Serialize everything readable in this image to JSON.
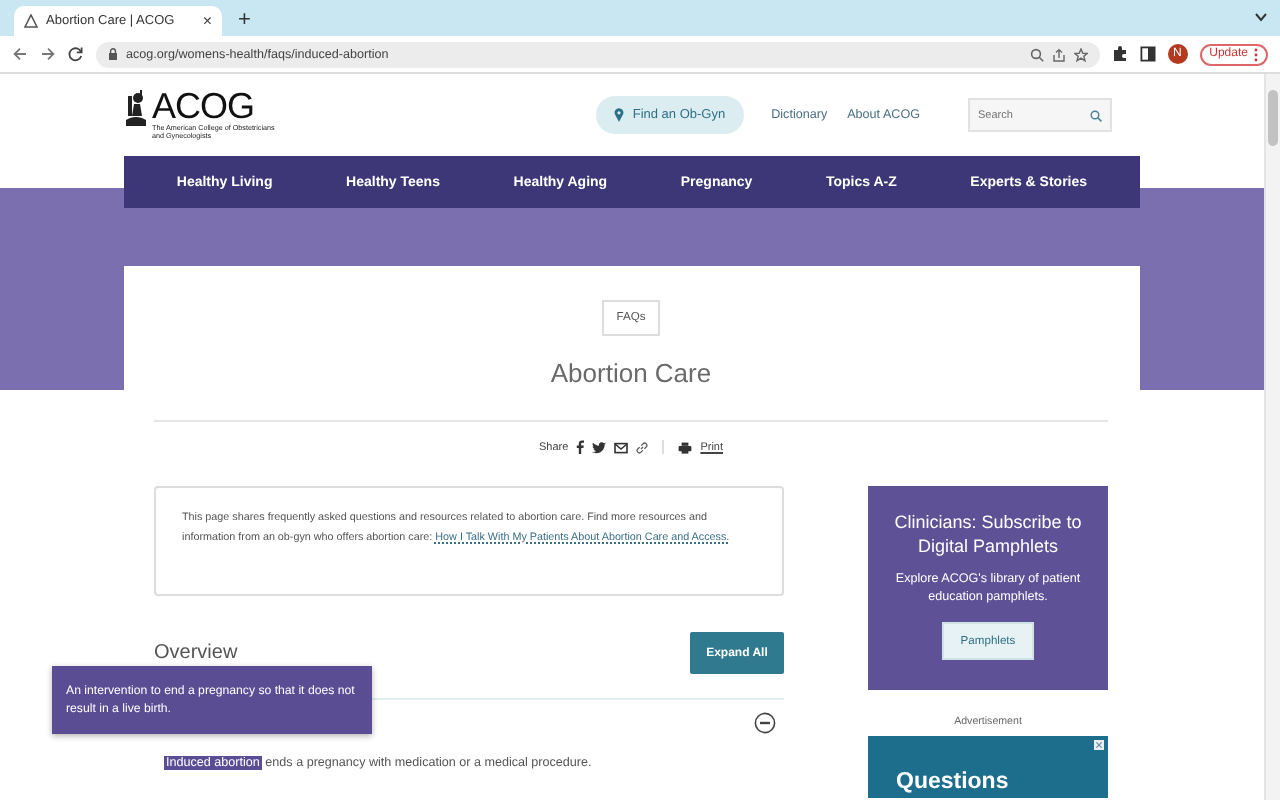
{
  "browser": {
    "tab_title": "Abortion Care | ACOG",
    "tab_close": "×",
    "new_tab": "+",
    "url": "acog.org/womens-health/faqs/induced-abortion",
    "profile_initial": "N",
    "update_label": "Update"
  },
  "header": {
    "logo_text": "ACOG",
    "logo_subtitle": "The American College of Obstetricians and Gynecologists",
    "find_button": "Find an Ob-Gyn",
    "links": [
      "Dictionary",
      "About ACOG"
    ],
    "search": {
      "placeholder": "Search"
    }
  },
  "nav": [
    {
      "label": "Healthy Living"
    },
    {
      "label": "Healthy Teens"
    },
    {
      "label": "Healthy Aging"
    },
    {
      "label": "Pregnancy"
    },
    {
      "label": "Topics A-Z"
    },
    {
      "label": "Experts & Stories"
    }
  ],
  "article": {
    "tag": "FAQs",
    "title": "Abortion Care",
    "share_label": "Share",
    "print_label": "Print",
    "intro": {
      "text": "This page shares frequently asked questions and resources related to abortion care. Find more resources and information from an ob-gyn who offers abortion care:",
      "link": "How I Talk With My Patients About Abortion Care and Access."
    },
    "section_title": "Overview",
    "expand_button": "Expand All",
    "accordion": {
      "expanded": true,
      "term": "Induced abortion",
      "text": "ends a pregnancy with medication or a medical procedure."
    }
  },
  "tooltip": {
    "text": "An intervention to end a pregnancy so that it does not result in a live birth."
  },
  "sidebar": {
    "promo": {
      "title": "Clinicians: Subscribe to Digital Pamphlets",
      "text": "Explore ACOG's library of patient education pamphlets.",
      "button": "Pamphlets"
    },
    "ad_label": "Advertisement",
    "ad_headline": "Questions"
  }
}
